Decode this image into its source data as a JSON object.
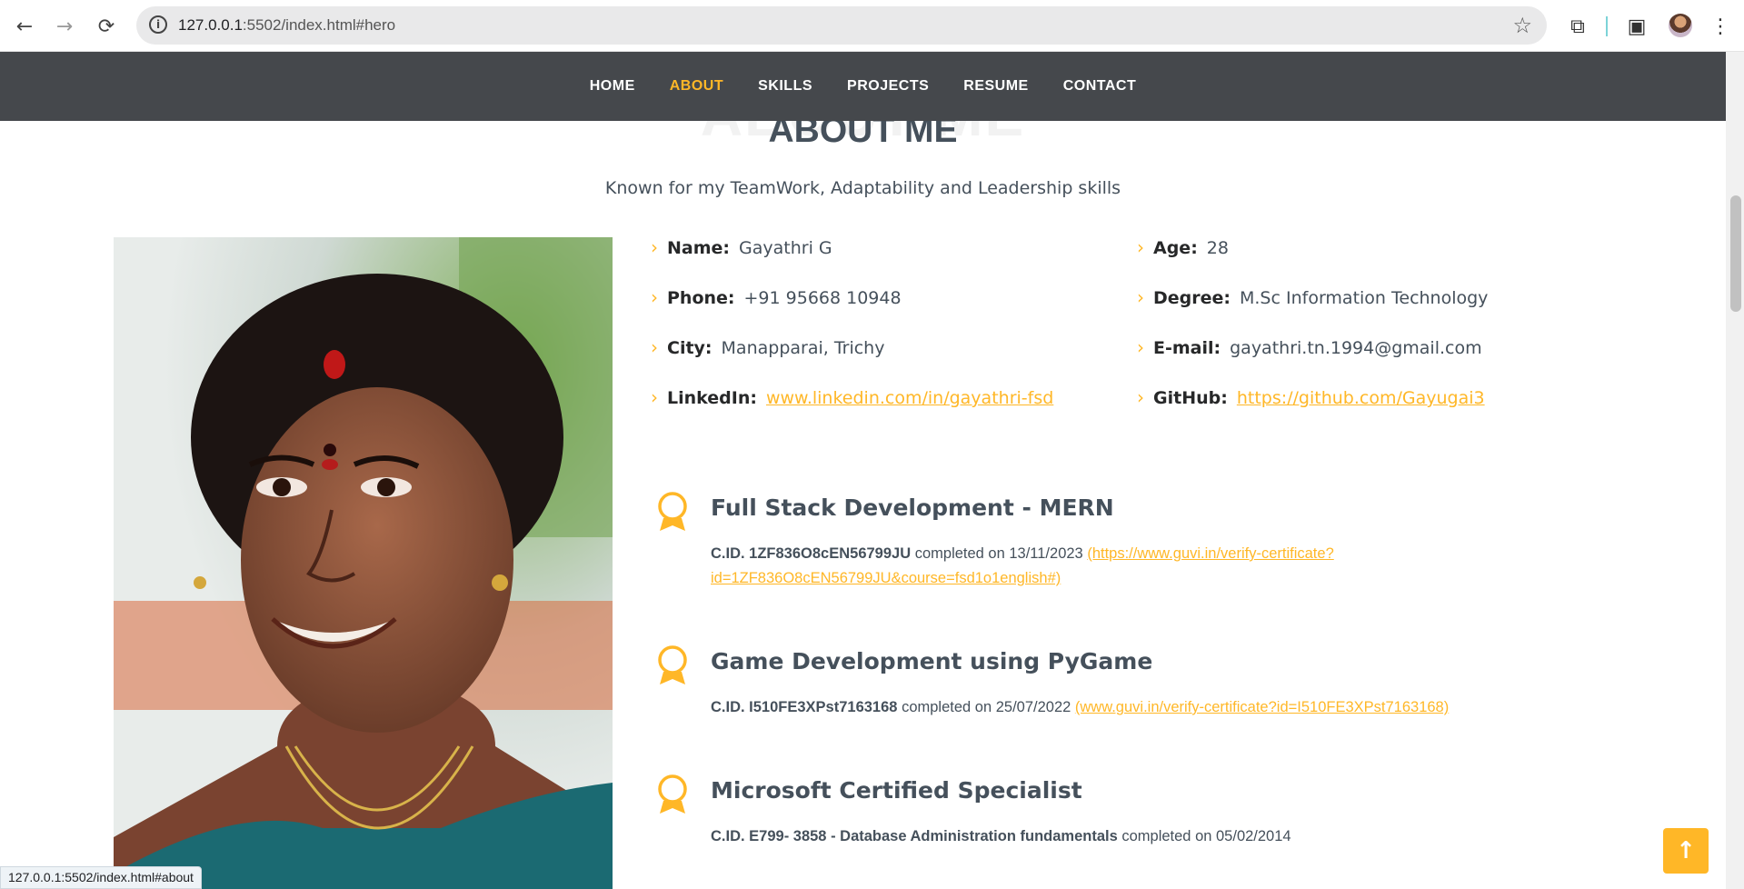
{
  "browser": {
    "url_host": "127.0.0.1",
    "url_rest": ":5502/index.html#hero",
    "status_url": "127.0.0.1:5502/index.html#about"
  },
  "nav": [
    "HOME",
    "ABOUT",
    "SKILLS",
    "PROJECTS",
    "RESUME",
    "CONTACT"
  ],
  "nav_active": "ABOUT",
  "section": {
    "bg_title": "ABOUT ME",
    "title": "ABOUT ME",
    "subtitle": "Known for my TeamWork, Adaptability and Leadership skills"
  },
  "info": {
    "name": {
      "label": "Name:",
      "value": "Gayathri G"
    },
    "age": {
      "label": "Age:",
      "value": "28"
    },
    "phone": {
      "label": "Phone:",
      "value": "+91 95668 10948"
    },
    "degree": {
      "label": "Degree:",
      "value": "M.Sc Information Technology"
    },
    "city": {
      "label": "City:",
      "value": "Manapparai, Trichy"
    },
    "email": {
      "label": "E-mail:",
      "value": "gayathri.tn.1994@gmail.com"
    },
    "linkedin": {
      "label": "LinkedIn:",
      "value": "www.linkedin.com/in/gayathri-fsd"
    },
    "github": {
      "label": "GitHub:",
      "value": "https://github.com/Gayugai3"
    }
  },
  "certs": [
    {
      "title": "Full Stack Development - MERN",
      "cid": "C.ID. 1ZF836O8cEN56799JU",
      "completed": "completed on 13/11/2023",
      "link_line1": "(https://www.guvi.in/verify-certificate?",
      "link_line2": "id=1ZF836O8cEN56799JU&course=fsd1o1english#)"
    },
    {
      "title": "Game Development using PyGame",
      "cid": "C.ID. I510FE3XPst7163168",
      "completed": "completed on 25/07/2022",
      "link": "(www.guvi.in/verify-certificate?id=I510FE3XPst7163168)"
    },
    {
      "title": "Microsoft Certified Specialist",
      "cid": "C.ID. E799- 3858 - Database Administration fundamentals",
      "completed": "completed on 05/02/2014"
    }
  ],
  "colors": {
    "accent": "#ffb727",
    "nav_bg": "#45484c",
    "text": "#45505b"
  },
  "icons": [
    "back-arrow-icon",
    "forward-arrow-icon",
    "reload-icon",
    "site-info-icon",
    "bookmark-star-icon",
    "extensions-icon",
    "side-panel-icon",
    "menu-kebab-icon",
    "chevron-right-icon",
    "award-icon",
    "arrow-up-icon"
  ]
}
